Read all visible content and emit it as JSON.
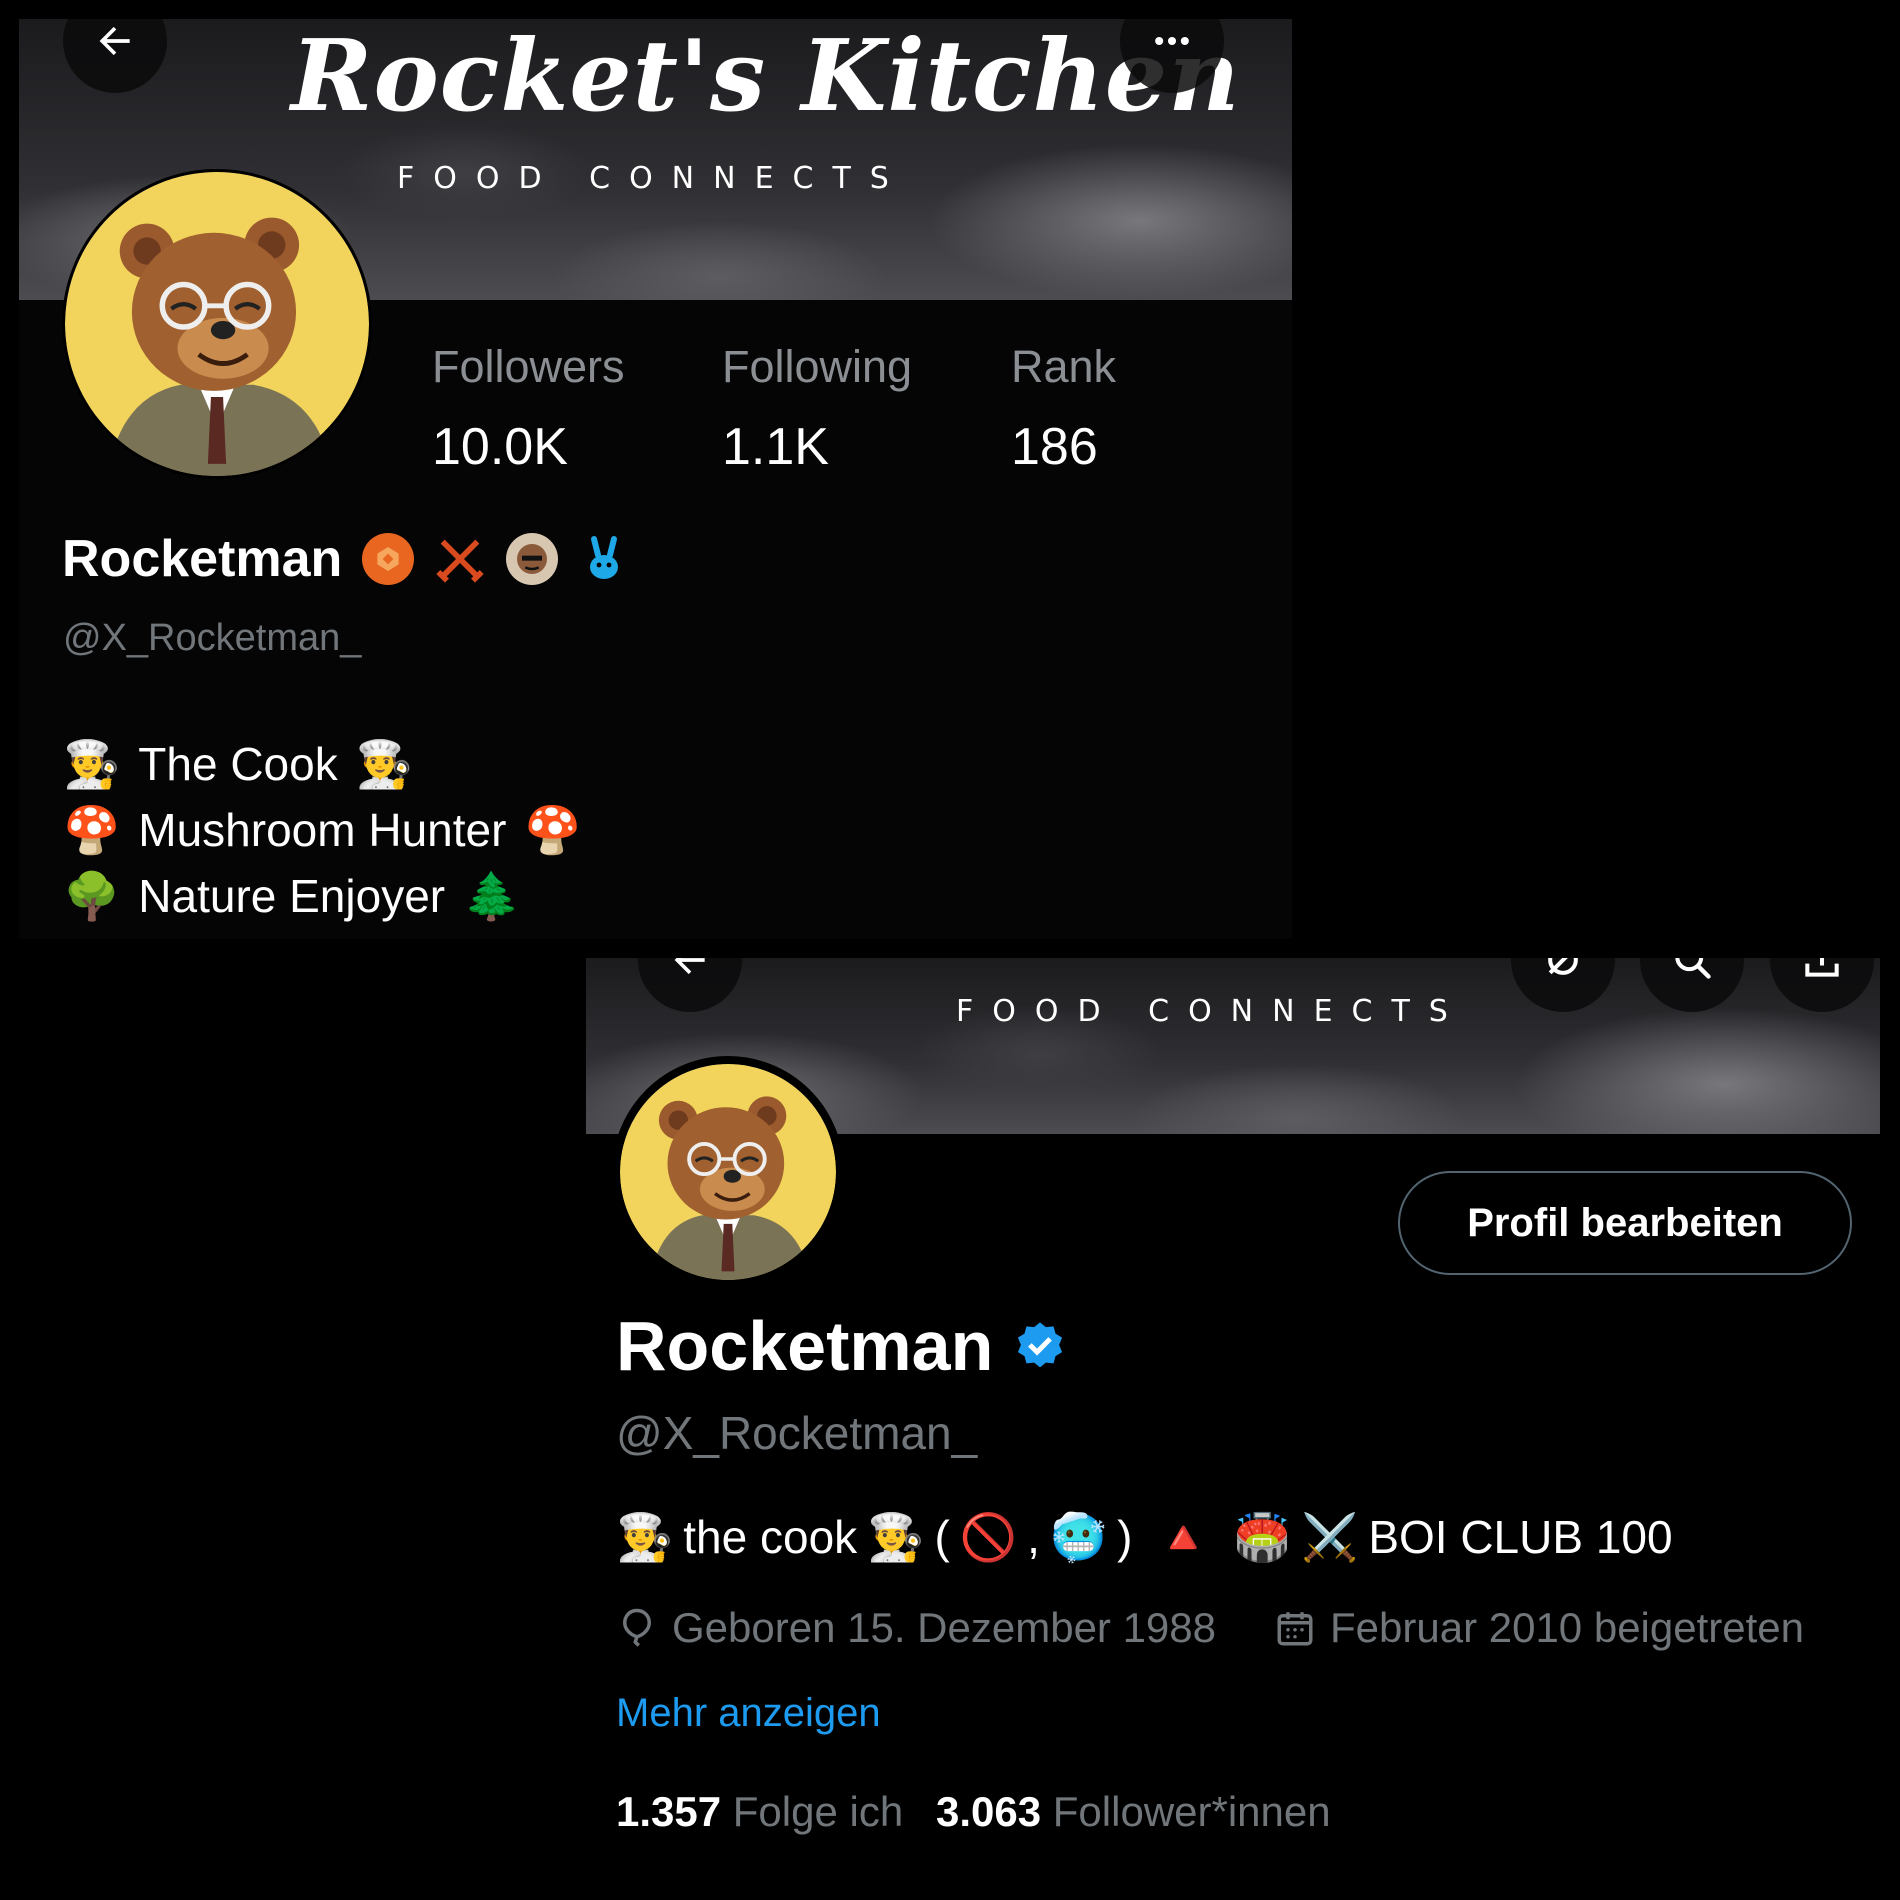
{
  "card_a": {
    "banner": {
      "brand_title": "Rocket's Kitchen",
      "tagline": "FOOD CONNECTS"
    },
    "stats": [
      {
        "label": "Followers",
        "value": "10.0K"
      },
      {
        "label": "Following",
        "value": "1.1K"
      },
      {
        "label": "Rank",
        "value": "186"
      }
    ],
    "profile": {
      "name": "Rocketman",
      "handle": "@X_Rocketman_"
    },
    "bio": [
      {
        "lead_emoji": "👨‍🍳",
        "text": "The Cook",
        "trail_emoji": "👨‍🍳"
      },
      {
        "lead_emoji": "🍄",
        "text": "Mushroom Hunter",
        "trail_emoji": "🍄"
      },
      {
        "lead_emoji": "🌳",
        "text": "Nature Enjoyer",
        "trail_emoji": "🌲"
      }
    ],
    "icons": [
      "back-arrow-icon",
      "more-icon",
      "badge-icons"
    ]
  },
  "card_b": {
    "banner": {
      "tagline": "FOOD CONNECTS"
    },
    "edit_button": "Profil bearbeiten",
    "profile": {
      "name": "Rocketman",
      "handle": "@X_Rocketman_"
    },
    "bio": {
      "chef": "👨‍🍳",
      "text1": "the cook",
      "paren_open": "(",
      "no_entry": "🚫",
      "comma": ",",
      "cold": "🥶",
      "paren_close": ")",
      "triangle": "🔺",
      "stadium": "🏟️",
      "swords": "⚔️",
      "text2": "BOI CLUB 100"
    },
    "birthday": "Geboren 15. Dezember 1988",
    "joined": "Februar 2010 beigetreten",
    "more_link": "Mehr anzeigen",
    "following_count": "1.357",
    "following_label": "Folge ich",
    "followers_count": "3.063",
    "followers_label": "Follower*innen"
  },
  "colors": {
    "link": "#1d9bf0",
    "verified": "#1d9bf0",
    "muted": "#71767b",
    "background": "#000000"
  }
}
